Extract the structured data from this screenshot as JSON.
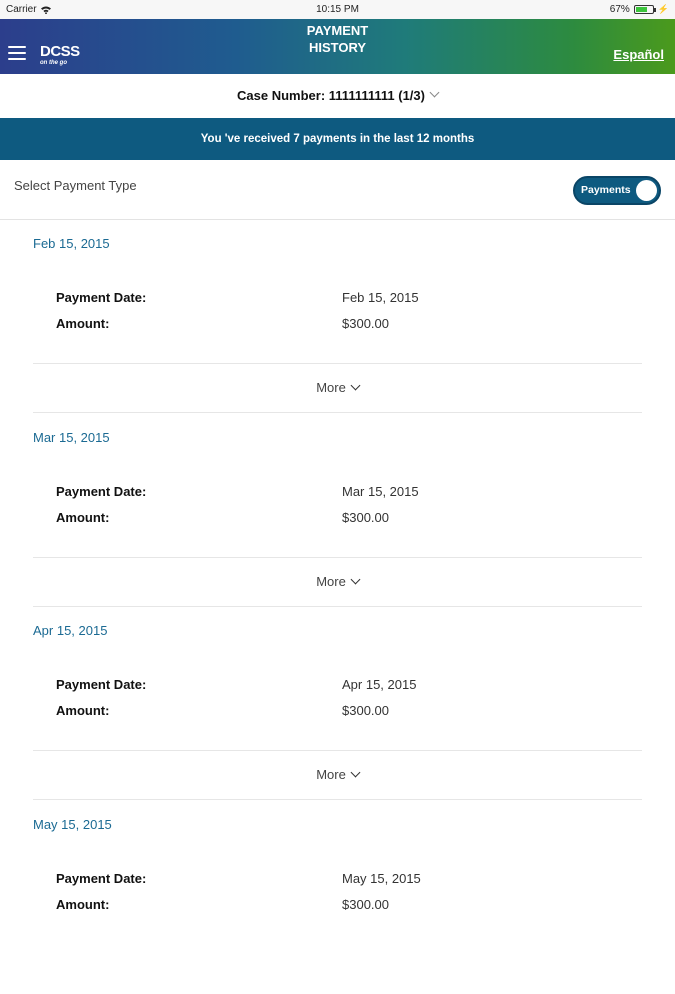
{
  "status_bar": {
    "carrier": "Carrier",
    "time": "10:15 PM",
    "battery": "67%",
    "battery_level": 0.67
  },
  "header": {
    "title_line1": "PAYMENT",
    "title_line2": "HISTORY",
    "logo_main": "DCSS",
    "logo_sub": "on the go",
    "language_link": "Español"
  },
  "case": {
    "label": "Case Number: 1111111111 (1/3)"
  },
  "summary": {
    "text": "You 've received 7 payments in the last 12 months"
  },
  "payment_type": {
    "label": "Select Payment Type",
    "toggle_label": "Payments"
  },
  "field_labels": {
    "date": "Payment Date:",
    "amount": "Amount:"
  },
  "more_label": "More",
  "payments": [
    {
      "heading": "Feb 15, 2015",
      "date": "Feb 15, 2015",
      "amount": "$300.00"
    },
    {
      "heading": "Mar 15, 2015",
      "date": "Mar 15, 2015",
      "amount": "$300.00"
    },
    {
      "heading": "Apr 15, 2015",
      "date": "Apr 15, 2015",
      "amount": "$300.00"
    },
    {
      "heading": "May 15, 2015",
      "date": "May 15, 2015",
      "amount": "$300.00"
    }
  ],
  "colors": {
    "header_start": "#2c3e8c",
    "header_end": "#4b9a1c",
    "banner": "#0e5a80",
    "accent_text": "#1b6a93"
  }
}
